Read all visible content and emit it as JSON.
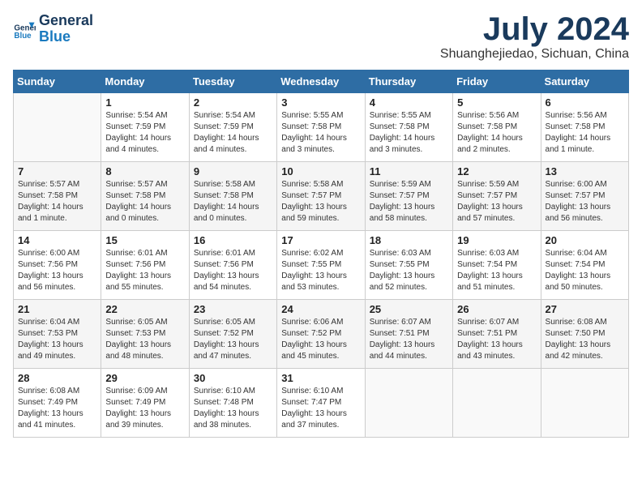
{
  "header": {
    "logo_line1": "General",
    "logo_line2": "Blue",
    "month_title": "July 2024",
    "location": "Shuanghejiedao, Sichuan, China"
  },
  "weekdays": [
    "Sunday",
    "Monday",
    "Tuesday",
    "Wednesday",
    "Thursday",
    "Friday",
    "Saturday"
  ],
  "weeks": [
    [
      {
        "day": "",
        "text": ""
      },
      {
        "day": "1",
        "text": "Sunrise: 5:54 AM\nSunset: 7:59 PM\nDaylight: 14 hours\nand 4 minutes."
      },
      {
        "day": "2",
        "text": "Sunrise: 5:54 AM\nSunset: 7:59 PM\nDaylight: 14 hours\nand 4 minutes."
      },
      {
        "day": "3",
        "text": "Sunrise: 5:55 AM\nSunset: 7:58 PM\nDaylight: 14 hours\nand 3 minutes."
      },
      {
        "day": "4",
        "text": "Sunrise: 5:55 AM\nSunset: 7:58 PM\nDaylight: 14 hours\nand 3 minutes."
      },
      {
        "day": "5",
        "text": "Sunrise: 5:56 AM\nSunset: 7:58 PM\nDaylight: 14 hours\nand 2 minutes."
      },
      {
        "day": "6",
        "text": "Sunrise: 5:56 AM\nSunset: 7:58 PM\nDaylight: 14 hours\nand 1 minute."
      }
    ],
    [
      {
        "day": "7",
        "text": "Sunrise: 5:57 AM\nSunset: 7:58 PM\nDaylight: 14 hours\nand 1 minute."
      },
      {
        "day": "8",
        "text": "Sunrise: 5:57 AM\nSunset: 7:58 PM\nDaylight: 14 hours\nand 0 minutes."
      },
      {
        "day": "9",
        "text": "Sunrise: 5:58 AM\nSunset: 7:58 PM\nDaylight: 14 hours\nand 0 minutes."
      },
      {
        "day": "10",
        "text": "Sunrise: 5:58 AM\nSunset: 7:57 PM\nDaylight: 13 hours\nand 59 minutes."
      },
      {
        "day": "11",
        "text": "Sunrise: 5:59 AM\nSunset: 7:57 PM\nDaylight: 13 hours\nand 58 minutes."
      },
      {
        "day": "12",
        "text": "Sunrise: 5:59 AM\nSunset: 7:57 PM\nDaylight: 13 hours\nand 57 minutes."
      },
      {
        "day": "13",
        "text": "Sunrise: 6:00 AM\nSunset: 7:57 PM\nDaylight: 13 hours\nand 56 minutes."
      }
    ],
    [
      {
        "day": "14",
        "text": "Sunrise: 6:00 AM\nSunset: 7:56 PM\nDaylight: 13 hours\nand 56 minutes."
      },
      {
        "day": "15",
        "text": "Sunrise: 6:01 AM\nSunset: 7:56 PM\nDaylight: 13 hours\nand 55 minutes."
      },
      {
        "day": "16",
        "text": "Sunrise: 6:01 AM\nSunset: 7:56 PM\nDaylight: 13 hours\nand 54 minutes."
      },
      {
        "day": "17",
        "text": "Sunrise: 6:02 AM\nSunset: 7:55 PM\nDaylight: 13 hours\nand 53 minutes."
      },
      {
        "day": "18",
        "text": "Sunrise: 6:03 AM\nSunset: 7:55 PM\nDaylight: 13 hours\nand 52 minutes."
      },
      {
        "day": "19",
        "text": "Sunrise: 6:03 AM\nSunset: 7:54 PM\nDaylight: 13 hours\nand 51 minutes."
      },
      {
        "day": "20",
        "text": "Sunrise: 6:04 AM\nSunset: 7:54 PM\nDaylight: 13 hours\nand 50 minutes."
      }
    ],
    [
      {
        "day": "21",
        "text": "Sunrise: 6:04 AM\nSunset: 7:53 PM\nDaylight: 13 hours\nand 49 minutes."
      },
      {
        "day": "22",
        "text": "Sunrise: 6:05 AM\nSunset: 7:53 PM\nDaylight: 13 hours\nand 48 minutes."
      },
      {
        "day": "23",
        "text": "Sunrise: 6:05 AM\nSunset: 7:52 PM\nDaylight: 13 hours\nand 47 minutes."
      },
      {
        "day": "24",
        "text": "Sunrise: 6:06 AM\nSunset: 7:52 PM\nDaylight: 13 hours\nand 45 minutes."
      },
      {
        "day": "25",
        "text": "Sunrise: 6:07 AM\nSunset: 7:51 PM\nDaylight: 13 hours\nand 44 minutes."
      },
      {
        "day": "26",
        "text": "Sunrise: 6:07 AM\nSunset: 7:51 PM\nDaylight: 13 hours\nand 43 minutes."
      },
      {
        "day": "27",
        "text": "Sunrise: 6:08 AM\nSunset: 7:50 PM\nDaylight: 13 hours\nand 42 minutes."
      }
    ],
    [
      {
        "day": "28",
        "text": "Sunrise: 6:08 AM\nSunset: 7:49 PM\nDaylight: 13 hours\nand 41 minutes."
      },
      {
        "day": "29",
        "text": "Sunrise: 6:09 AM\nSunset: 7:49 PM\nDaylight: 13 hours\nand 39 minutes."
      },
      {
        "day": "30",
        "text": "Sunrise: 6:10 AM\nSunset: 7:48 PM\nDaylight: 13 hours\nand 38 minutes."
      },
      {
        "day": "31",
        "text": "Sunrise: 6:10 AM\nSunset: 7:47 PM\nDaylight: 13 hours\nand 37 minutes."
      },
      {
        "day": "",
        "text": ""
      },
      {
        "day": "",
        "text": ""
      },
      {
        "day": "",
        "text": ""
      }
    ]
  ]
}
